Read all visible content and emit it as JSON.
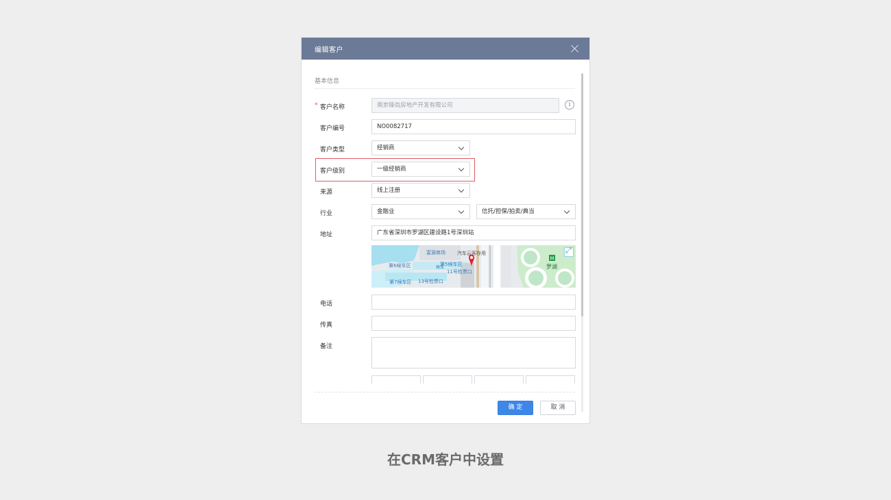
{
  "dialog": {
    "title": "编辑客户",
    "close_icon": "close-icon"
  },
  "section": {
    "title": "基本信息"
  },
  "fields": {
    "customer_name": {
      "label": "客户名称",
      "required_mark": "*",
      "value": "南京锋尚房地产开发有限公司",
      "info_icon": "info-icon",
      "info_glyph": "i"
    },
    "customer_no": {
      "label": "客户编号",
      "value": "NO0082717"
    },
    "customer_type": {
      "label": "客户类型",
      "value": "经销商"
    },
    "customer_level": {
      "label": "客户级别",
      "value": "一级经销商"
    },
    "source": {
      "label": "来源",
      "value": "线上注册"
    },
    "industry": {
      "label": "行业",
      "value": "金融业",
      "sub_value": "信托/担保/拍卖/典当"
    },
    "address": {
      "label": "地址",
      "value": "广东省深圳市罗湖区建设路1号深圳站"
    },
    "phone": {
      "label": "电话",
      "value": ""
    },
    "fax": {
      "label": "传真",
      "value": ""
    },
    "remark": {
      "label": "备注",
      "value": ""
    }
  },
  "map": {
    "labels": [
      "富源商场",
      "汽车云客存用",
      "第6候车区",
      "第5候车区",
      "11号检票口",
      "13号检票口",
      "第7候车区",
      "罗湖",
      "候车"
    ],
    "colors": {
      "water": "#a6dff0",
      "green": "#cdeccb",
      "road": "#ffffff",
      "pin": "#e02330",
      "building": "#dfe2e6"
    },
    "expand_icon": "expand-icon"
  },
  "buttons": {
    "confirm": "确 定",
    "cancel": "取 消"
  },
  "caption": "在CRM客户中设置",
  "colors": {
    "header": "#6b7a96",
    "primary": "#3e86e8",
    "highlight_border": "#e25b63",
    "page_bg": "#eeeeee"
  }
}
